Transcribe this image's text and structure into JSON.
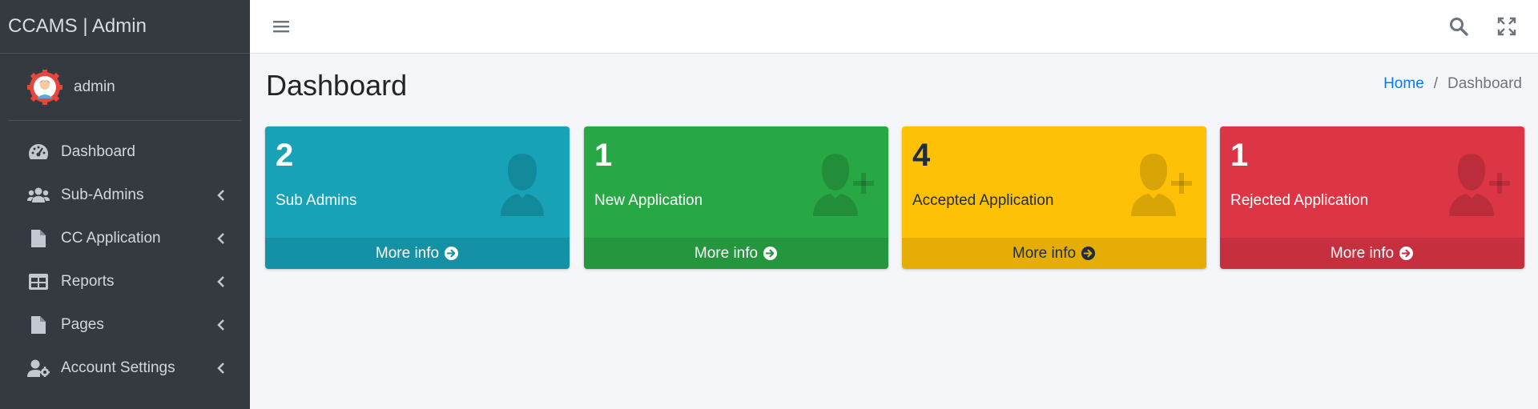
{
  "brand": {
    "title": "CCAMS | Admin"
  },
  "user": {
    "name": "admin"
  },
  "sidebar": {
    "items": [
      {
        "label": "Dashboard",
        "icon": "dashboard-icon"
      },
      {
        "label": "Sub-Admins",
        "icon": "users-icon"
      },
      {
        "label": "CC Application",
        "icon": "file-icon"
      },
      {
        "label": "Reports",
        "icon": "table-icon"
      },
      {
        "label": "Pages",
        "icon": "file-icon"
      },
      {
        "label": "Account Settings",
        "icon": "user-cog-icon"
      }
    ]
  },
  "header": {
    "title": "Dashboard",
    "breadcrumb": {
      "home": "Home",
      "separator": "/",
      "current": "Dashboard"
    }
  },
  "boxes": [
    {
      "count": "2",
      "label": "Sub Admins",
      "footer": "More info",
      "color": "#17a2b8",
      "footer_color": "#1591a5",
      "icon": "user-icon"
    },
    {
      "count": "1",
      "label": "New Application",
      "footer": "More info",
      "color": "#28a745",
      "footer_color": "#24963e",
      "icon": "user-plus-icon"
    },
    {
      "count": "4",
      "label": "Accepted Application",
      "footer": "More info",
      "color": "#ffc107",
      "footer_color": "#e5ad06",
      "icon": "user-plus-icon"
    },
    {
      "count": "1",
      "label": "Rejected Application",
      "footer": "More info",
      "color": "#dc3545",
      "footer_color": "#c6303e",
      "icon": "user-plus-icon"
    }
  ]
}
